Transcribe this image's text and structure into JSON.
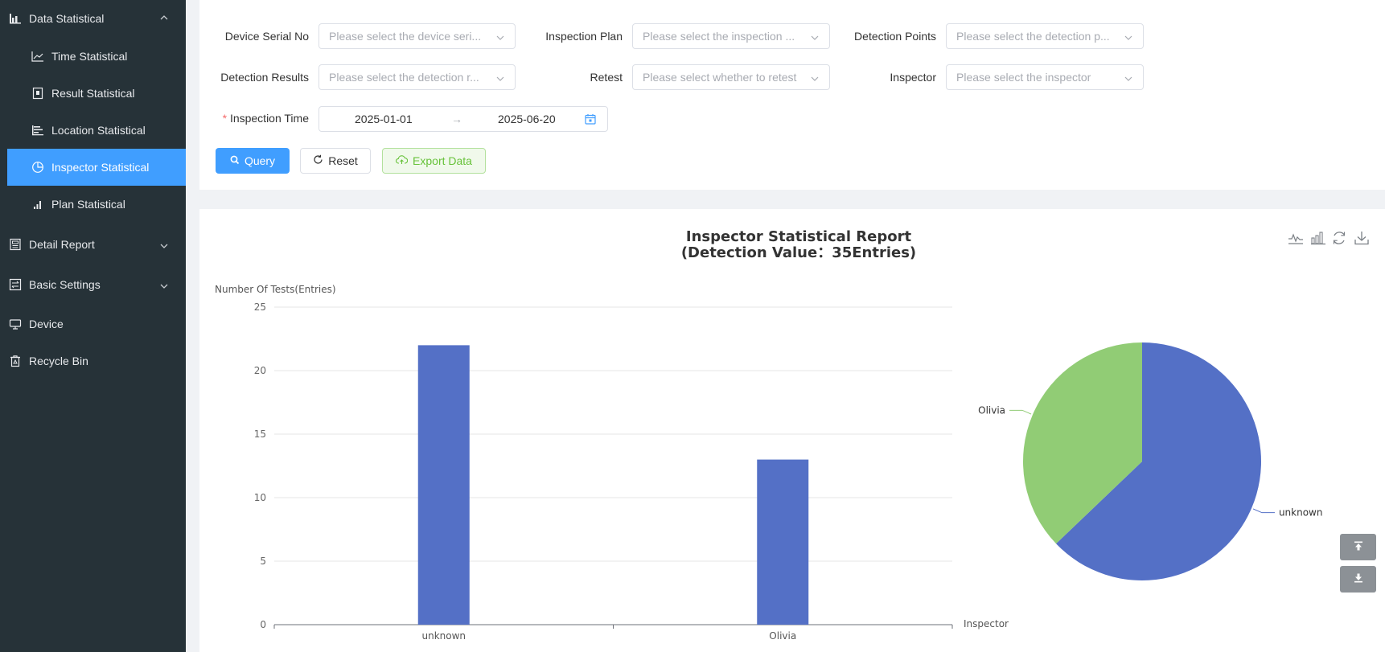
{
  "sidebar": {
    "data_statistical": "Data Statistical",
    "items": [
      {
        "label": "Time Statistical"
      },
      {
        "label": "Result Statistical"
      },
      {
        "label": "Location Statistical"
      },
      {
        "label": "Inspector Statistical"
      },
      {
        "label": "Plan Statistical"
      }
    ],
    "detail_report": "Detail Report",
    "basic_settings": "Basic Settings",
    "device": "Device",
    "recycle_bin": "Recycle Bin",
    "active_color": "#409eff",
    "bg_color": "#263238"
  },
  "filters": {
    "device_serial_label": "Device Serial No",
    "device_serial_placeholder": "Please select the device seri...",
    "inspection_plan_label": "Inspection Plan",
    "inspection_plan_placeholder": "Please select the inspection ...",
    "detection_points_label": "Detection Points",
    "detection_points_placeholder": "Please select the detection p...",
    "detection_results_label": "Detection Results",
    "detection_results_placeholder": "Please select the detection r...",
    "retest_label": "Retest",
    "retest_placeholder": "Please select whether to retest",
    "inspector_label": "Inspector",
    "inspector_placeholder": "Please select the inspector",
    "required_mark": "*",
    "inspection_time_label": "Inspection Time",
    "start_date": "2025-01-01",
    "arrow": "→",
    "end_date": "2025-06-20"
  },
  "buttons": {
    "query": "Query",
    "reset": "Reset",
    "export": "Export Data"
  },
  "chart_data": [
    {
      "type": "bar",
      "title": "Inspector Statistical Report",
      "subtitle": "(Detection Value：35Entries)",
      "ylabel": "Number Of Tests(Entries)",
      "xlabel": "Inspector",
      "categories": [
        "unknown",
        "Olivia"
      ],
      "values": [
        22,
        13
      ],
      "ylim": [
        0,
        25
      ],
      "yticks": [
        0,
        5,
        10,
        15,
        20,
        25
      ],
      "color": "#5470c6",
      "grid": true
    },
    {
      "type": "pie",
      "labels": [
        "unknown",
        "Olivia"
      ],
      "values": [
        22,
        13
      ],
      "colors": [
        "#5470c6",
        "#91cc75"
      ]
    }
  ],
  "toolbox": [
    "line-chart-icon",
    "bar-chart-icon",
    "restore-icon",
    "download-icon"
  ],
  "scroll_buttons": [
    "scroll-top-icon",
    "scroll-bottom-icon"
  ]
}
